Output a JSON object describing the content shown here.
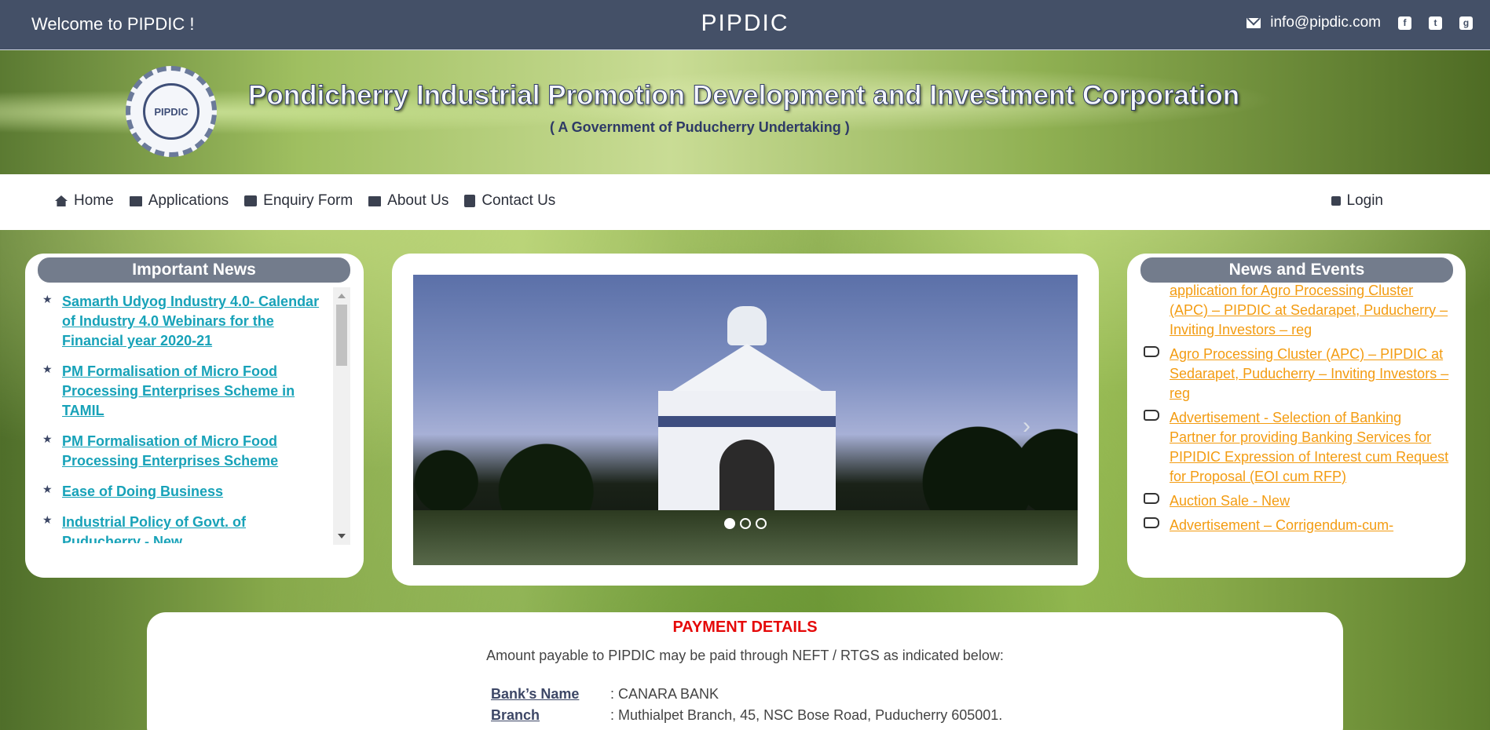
{
  "topbar": {
    "welcome": "Welcome to PIPDIC !",
    "brand": "PIPDIC",
    "email": "info@pipdic.com",
    "social_icons": [
      "facebook-icon",
      "twitter-icon",
      "google-plus-icon"
    ]
  },
  "header": {
    "logo_text": "PIPDIC",
    "org_name": "Pondicherry Industrial Promotion Development and Investment Corporation",
    "subtitle": "( A Government of Puducherry Undertaking )"
  },
  "nav": {
    "items": [
      {
        "label": "Home",
        "icon": "home-icon"
      },
      {
        "label": "Applications",
        "icon": "monitor-icon"
      },
      {
        "label": "Enquiry Form",
        "icon": "envelope-icon"
      },
      {
        "label": "About Us",
        "icon": "monitor-icon"
      },
      {
        "label": "Contact Us",
        "icon": "contact-card-icon"
      }
    ],
    "login": "Login"
  },
  "important_news": {
    "title": "Important News",
    "items": [
      "Samarth Udyog Industry 4.0- Calendar of Industry 4.0 Webinars for the Financial year 2020-21",
      "PM Formalisation of Micro Food Processing Enterprises Scheme in TAMIL",
      "PM Formalisation of Micro Food Processing Enterprises Scheme",
      "Ease of Doing Business",
      "Industrial Policy of Govt. of Puducherry - New"
    ]
  },
  "slider": {
    "slide_count": 3,
    "active_slide": 1
  },
  "news_events": {
    "title": "News and Events",
    "items": [
      "application for Agro Processing Cluster (APC) – PIPDIC at Sedarapet, Puducherry – Inviting Investors – reg",
      "Agro Processing Cluster (APC) – PIPDIC at Sedarapet, Puducherry – Inviting Investors – reg",
      "Advertisement - Selection of Banking Partner for providing Banking Services for PIPIDIC Expression of Interest cum Request for Proposal (EOI cum RFP)",
      "Auction Sale - New",
      "Advertisement – Corrigendum-cum-"
    ]
  },
  "payment": {
    "title": "PAYMENT DETAILS",
    "subtitle": "Amount payable to PIPDIC may be paid through NEFT / RTGS as indicated below:",
    "rows": [
      {
        "key": "Bank’s Name",
        "value": ": CANARA BANK"
      },
      {
        "key": "Branch",
        "value": ": Muthialpet Branch, 45, NSC Bose Road, Puducherry 605001."
      }
    ]
  },
  "colors": {
    "topbar": "#445067",
    "news_link": "#17a2b8",
    "events_link": "#f39c12",
    "payment_title": "#e50909"
  }
}
